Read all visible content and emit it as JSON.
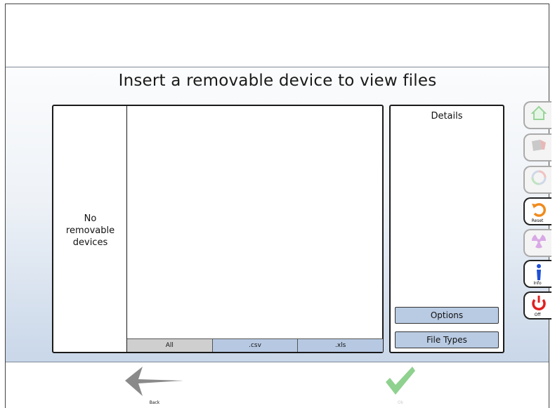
{
  "header": {
    "title": "Insert a removable device to view files"
  },
  "devices_panel": {
    "empty_message_line1": "No",
    "empty_message_line2": "removable",
    "empty_message_line3": "devices"
  },
  "file_tabs": [
    {
      "label": "All",
      "selected": true
    },
    {
      "label": ".csv",
      "selected": false
    },
    {
      "label": ".xls",
      "selected": false
    }
  ],
  "details_panel": {
    "title": "Details",
    "options_label": "Options",
    "file_types_label": "File Types"
  },
  "side_buttons": [
    {
      "icon": "home-icon",
      "label": "",
      "enabled": false
    },
    {
      "icon": "eraser-icon",
      "label": "",
      "enabled": false
    },
    {
      "icon": "color-wheel-icon",
      "label": "",
      "enabled": false
    },
    {
      "icon": "reset-icon",
      "label": "Reset",
      "enabled": true
    },
    {
      "icon": "radiation-icon",
      "label": "",
      "enabled": false
    },
    {
      "icon": "info-icon",
      "label": "Info",
      "enabled": true
    },
    {
      "icon": "power-icon",
      "label": "Off",
      "enabled": true
    }
  ],
  "footer": {
    "back_label": "Back",
    "ok_label": "Ok"
  },
  "colors": {
    "accent_blue": "#b9cbe3",
    "power_red": "#e02020",
    "reset_orange": "#f08a1c",
    "info_blue": "#1f4fd6",
    "ok_green": "#8fd18f"
  }
}
